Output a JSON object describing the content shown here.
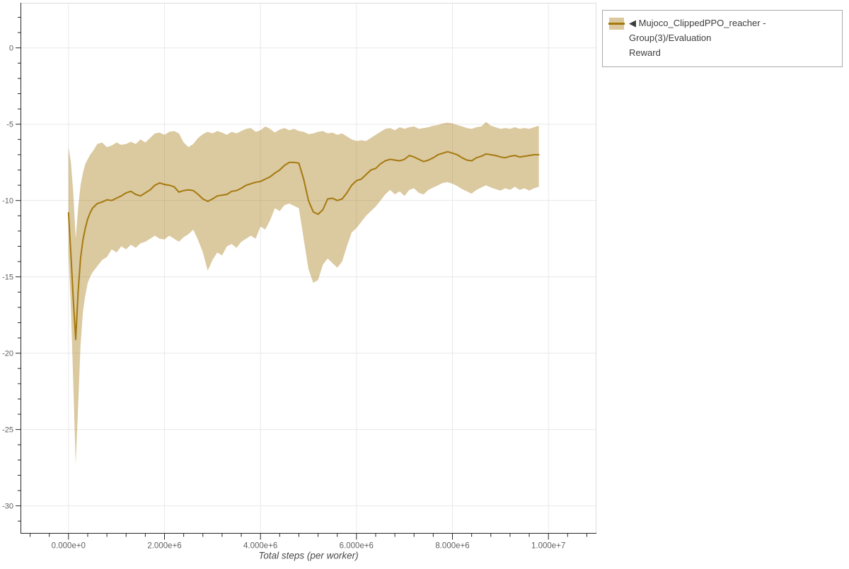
{
  "page": {
    "background": "#ffffff"
  },
  "legend": {
    "items": [
      {
        "label": "◀ Mujoco_ClippedPPO_reacher - Group(3)/Evaluation Reward",
        "label_line1": "◀ Mujoco_ClippedPPO_reacher - Group(3)/Evaluation",
        "label_line2": "Reward",
        "line_color": "#a5790e",
        "band_color": "#dbc89e"
      }
    ]
  },
  "chart_data": {
    "type": "line",
    "title": "",
    "xlabel": "Total steps (per worker)",
    "ylabel": "",
    "xlim": [
      -1000000,
      11000000
    ],
    "ylim": [
      -31.8,
      2.95
    ],
    "grid": true,
    "legend_position": "outside-top-right",
    "x_major_ticks": [
      0,
      2000000,
      4000000,
      6000000,
      8000000,
      10000000
    ],
    "x_tick_labels": [
      "0.000e+0",
      "2.000e+6",
      "4.000e+6",
      "6.000e+6",
      "8.000e+6",
      "1.000e+7"
    ],
    "x_minor_step": 400000,
    "y_major_ticks": [
      0,
      -5,
      -10,
      -15,
      -20,
      -25,
      -30
    ],
    "y_tick_labels": [
      "0",
      "-5",
      "-10",
      "-15",
      "-20",
      "-25",
      "-30"
    ],
    "y_minor_step": 1,
    "colors": {
      "grid": "#e8e8e8",
      "outline": "#dcdcdc",
      "axis": "#262626",
      "line": "#a5790e",
      "band_rgba": "rgba(165,121,14,0.40)"
    },
    "series": [
      {
        "name": "Mujoco_ClippedPPO_reacher - Group(3)/Evaluation Reward",
        "x_millions": [
          0,
          0.05,
          0.1,
          0.15,
          0.2,
          0.25,
          0.3,
          0.35,
          0.4,
          0.45,
          0.5,
          0.6,
          0.7,
          0.8,
          0.9,
          1.0,
          1.1,
          1.2,
          1.3,
          1.4,
          1.5,
          1.6,
          1.7,
          1.8,
          1.9,
          2.0,
          2.1,
          2.2,
          2.3,
          2.4,
          2.5,
          2.6,
          2.7,
          2.8,
          2.9,
          3.0,
          3.1,
          3.2,
          3.3,
          3.4,
          3.5,
          3.6,
          3.7,
          3.8,
          3.9,
          4.0,
          4.1,
          4.2,
          4.3,
          4.4,
          4.5,
          4.6,
          4.7,
          4.8,
          4.9,
          5.0,
          5.1,
          5.2,
          5.3,
          5.4,
          5.5,
          5.6,
          5.7,
          5.8,
          5.9,
          6.0,
          6.1,
          6.2,
          6.3,
          6.4,
          6.5,
          6.6,
          6.7,
          6.8,
          6.9,
          7.0,
          7.1,
          7.2,
          7.3,
          7.4,
          7.5,
          7.6,
          7.7,
          7.8,
          7.9,
          8.0,
          8.1,
          8.2,
          8.3,
          8.4,
          8.5,
          8.6,
          8.7,
          8.8,
          8.9,
          9.0,
          9.1,
          9.2,
          9.3,
          9.4,
          9.5,
          9.6,
          9.7,
          9.8
        ],
        "mean": [
          -10.8,
          -13.5,
          -16.5,
          -19.1,
          -16.0,
          -13.8,
          -12.6,
          -11.8,
          -11.2,
          -10.8,
          -10.5,
          -10.2,
          -10.1,
          -9.95,
          -10.0,
          -9.85,
          -9.7,
          -9.5,
          -9.4,
          -9.6,
          -9.7,
          -9.5,
          -9.3,
          -9.0,
          -8.85,
          -8.95,
          -9.0,
          -9.1,
          -9.45,
          -9.35,
          -9.3,
          -9.35,
          -9.6,
          -9.9,
          -10.05,
          -9.9,
          -9.7,
          -9.65,
          -9.6,
          -9.4,
          -9.35,
          -9.2,
          -9.0,
          -8.9,
          -8.8,
          -8.75,
          -8.6,
          -8.45,
          -8.2,
          -8.0,
          -7.7,
          -7.5,
          -7.5,
          -7.55,
          -8.6,
          -10.0,
          -10.75,
          -10.9,
          -10.6,
          -9.9,
          -9.85,
          -10.0,
          -9.9,
          -9.5,
          -9.0,
          -8.7,
          -8.6,
          -8.3,
          -8.0,
          -7.9,
          -7.6,
          -7.4,
          -7.3,
          -7.35,
          -7.4,
          -7.3,
          -7.05,
          -7.15,
          -7.3,
          -7.45,
          -7.35,
          -7.2,
          -7.0,
          -6.9,
          -6.8,
          -6.9,
          -7.0,
          -7.2,
          -7.35,
          -7.4,
          -7.2,
          -7.1,
          -6.95,
          -7.0,
          -7.05,
          -7.15,
          -7.2,
          -7.1,
          -7.05,
          -7.15,
          -7.1,
          -7.05,
          -7.0,
          -7.0
        ],
        "band_upper": [
          -6.5,
          -7.5,
          -9.5,
          -12.5,
          -10.5,
          -9.0,
          -8.2,
          -7.6,
          -7.3,
          -7.0,
          -6.8,
          -6.3,
          -6.2,
          -6.5,
          -6.4,
          -6.2,
          -6.35,
          -6.3,
          -6.15,
          -6.3,
          -6.0,
          -6.2,
          -5.9,
          -5.6,
          -5.55,
          -5.7,
          -5.5,
          -5.45,
          -5.6,
          -6.2,
          -6.5,
          -6.3,
          -5.9,
          -5.65,
          -5.5,
          -5.6,
          -5.45,
          -5.55,
          -5.7,
          -5.5,
          -5.6,
          -5.45,
          -5.3,
          -5.25,
          -5.5,
          -5.4,
          -5.15,
          -5.3,
          -5.55,
          -5.35,
          -5.25,
          -5.4,
          -5.3,
          -5.45,
          -5.5,
          -5.65,
          -5.6,
          -5.5,
          -5.45,
          -5.6,
          -5.55,
          -5.7,
          -5.6,
          -5.8,
          -6.0,
          -6.1,
          -6.05,
          -6.1,
          -5.9,
          -5.7,
          -5.5,
          -5.3,
          -5.25,
          -5.4,
          -5.2,
          -5.3,
          -5.2,
          -5.15,
          -5.3,
          -5.25,
          -5.2,
          -5.1,
          -5.05,
          -4.95,
          -4.9,
          -4.95,
          -5.05,
          -5.15,
          -5.25,
          -5.3,
          -5.2,
          -5.15,
          -4.85,
          -5.1,
          -5.2,
          -5.3,
          -5.25,
          -5.3,
          -5.2,
          -5.3,
          -5.25,
          -5.3,
          -5.2,
          -5.1
        ],
        "band_lower": [
          -13.5,
          -17.0,
          -22.0,
          -27.3,
          -23.5,
          -19.5,
          -17.3,
          -16.2,
          -15.4,
          -15.0,
          -14.7,
          -14.3,
          -13.9,
          -13.7,
          -13.2,
          -13.4,
          -13.0,
          -13.2,
          -12.9,
          -13.1,
          -12.8,
          -12.7,
          -12.5,
          -12.3,
          -12.5,
          -12.55,
          -12.3,
          -12.5,
          -12.7,
          -12.4,
          -12.2,
          -11.9,
          -12.6,
          -13.4,
          -14.6,
          -13.9,
          -13.4,
          -13.6,
          -13.0,
          -12.85,
          -13.1,
          -12.7,
          -12.5,
          -12.3,
          -12.5,
          -11.7,
          -11.9,
          -11.3,
          -10.5,
          -10.7,
          -10.3,
          -10.2,
          -10.35,
          -10.5,
          -12.5,
          -14.5,
          -15.4,
          -15.2,
          -14.2,
          -13.8,
          -14.1,
          -14.4,
          -14.0,
          -13.0,
          -12.1,
          -11.8,
          -11.4,
          -11.0,
          -10.7,
          -10.4,
          -10.0,
          -9.6,
          -9.3,
          -9.6,
          -9.4,
          -9.7,
          -9.3,
          -9.2,
          -9.5,
          -9.6,
          -9.3,
          -9.15,
          -9.0,
          -8.85,
          -8.8,
          -8.9,
          -9.05,
          -9.25,
          -9.4,
          -9.55,
          -9.3,
          -9.15,
          -9.0,
          -9.15,
          -9.25,
          -9.35,
          -9.2,
          -9.3,
          -9.1,
          -9.3,
          -9.2,
          -9.35,
          -9.2,
          -9.1
        ]
      }
    ]
  }
}
